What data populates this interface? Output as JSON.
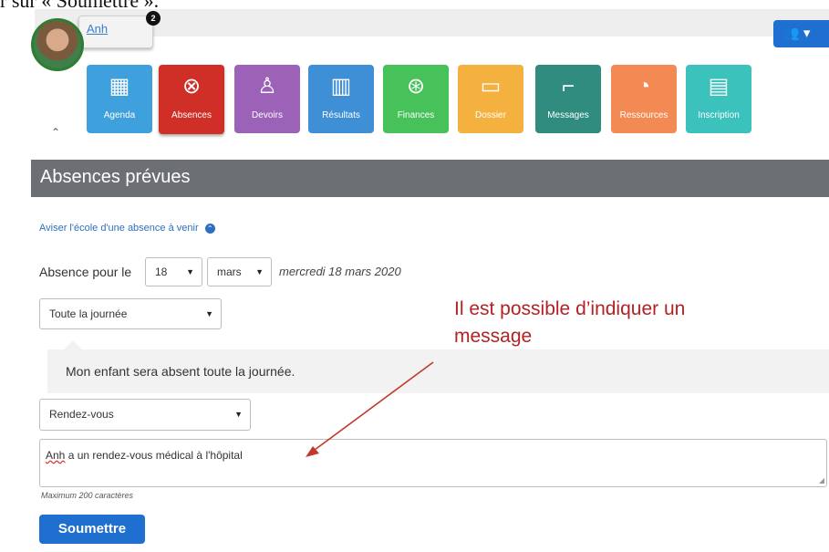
{
  "caption": "r sur « Soumettre ».",
  "user": {
    "name": "Anh",
    "notification_count": "2"
  },
  "group_button": {
    "icon": "users-icon",
    "chevron": "▾"
  },
  "nav_tiles": [
    {
      "label": "Agenda",
      "icon": "calendar-icon",
      "glyph": "▦",
      "color": "#3ea0dc"
    },
    {
      "label": "Absences",
      "icon": "absences-icon",
      "glyph": "⊗",
      "color": "#cf2f27",
      "active": true
    },
    {
      "label": "Devoirs",
      "icon": "homework-icon",
      "glyph": "♙",
      "color": "#9b62b8"
    },
    {
      "label": "Résultats",
      "icon": "bar-chart-icon",
      "glyph": "▥",
      "color": "#3f8fd6"
    },
    {
      "label": "Finances",
      "icon": "coin-icon",
      "glyph": "⊛",
      "color": "#47c25a"
    },
    {
      "label": "Dossier",
      "icon": "folder-icon",
      "glyph": "▭",
      "color": "#f4b13f"
    },
    {
      "label": "Messages",
      "icon": "message-icon",
      "glyph": "⌐",
      "color": "#2f8c7e"
    },
    {
      "label": "Ressources",
      "icon": "resources-icon",
      "glyph": "◔",
      "color": "#f38a54"
    },
    {
      "label": "Inscription",
      "icon": "inscription-icon",
      "glyph": "▤",
      "color": "#3cc2bd"
    }
  ],
  "header": {
    "title": "Absences prévues"
  },
  "aviser_link": "Aviser l'école d'une absence à venir",
  "absence_label": "Absence pour le",
  "day_select": "18",
  "month_select": "mars",
  "date_text": "mercredi 18 mars 2020",
  "duration_select": "Toute la journée",
  "info_message": "Mon enfant sera absent toute la journée.",
  "reason_select": "Rendez-vous",
  "message": {
    "underlined": "Anh",
    "rest": " a un rendez-vous médical à l'hôpital"
  },
  "hint": "Maximum 200 caractères",
  "submit_label": "Soumettre",
  "annotation": {
    "line1": "Il est possible d’indiquer un",
    "line2": "message",
    "color": "#b22222"
  }
}
